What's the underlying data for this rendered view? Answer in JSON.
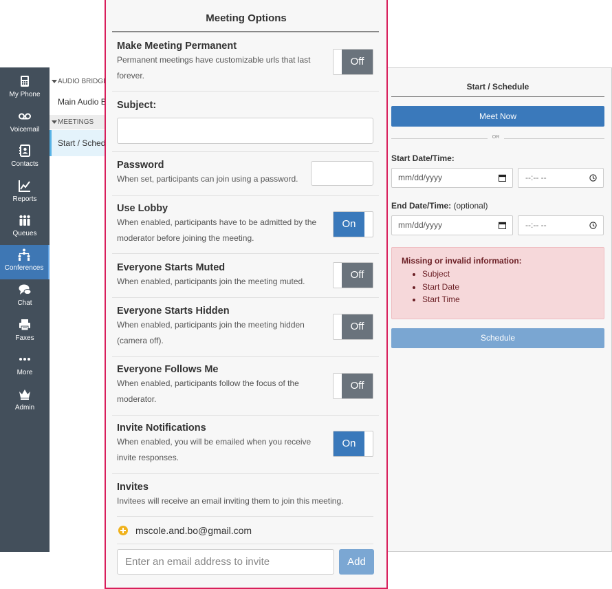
{
  "nav": {
    "items": [
      {
        "label": "My Phone",
        "icon": "phone-icon"
      },
      {
        "label": "Voicemail",
        "icon": "voicemail-icon"
      },
      {
        "label": "Contacts",
        "icon": "contacts-icon"
      },
      {
        "label": "Reports",
        "icon": "reports-icon"
      },
      {
        "label": "Queues",
        "icon": "queues-icon"
      },
      {
        "label": "Conferences",
        "icon": "conferences-icon",
        "active": true
      },
      {
        "label": "Chat",
        "icon": "chat-icon"
      },
      {
        "label": "Faxes",
        "icon": "fax-icon"
      },
      {
        "label": "More",
        "icon": "more-icon"
      },
      {
        "label": "Admin",
        "icon": "admin-crown-icon"
      }
    ]
  },
  "list": {
    "audio_header": "AUDIO BRIDGES",
    "audio_item": "Main Audio B",
    "meetings_header": "MEETINGS",
    "meetings_item": "Start / Schedu"
  },
  "schedule": {
    "title": "Start / Schedule",
    "meet_now": "Meet Now",
    "or": "OR",
    "start_label": "Start Date/Time:",
    "end_label": "End Date/Time:",
    "end_optional": "(optional)",
    "date_placeholder": "mm/dd/yyyy",
    "time_placeholder": "--:-- --",
    "error_title": "Missing or invalid information:",
    "errors": [
      "Subject",
      "Start Date",
      "Start Time"
    ],
    "schedule_button": "Schedule",
    "colors": {
      "primary": "#3a79bb",
      "alert_bg": "#f6d8da",
      "alert_text": "#6b1f25"
    }
  },
  "modal": {
    "title": "Meeting Options",
    "border_color": "#d81e5b",
    "permanent": {
      "heading": "Make Meeting Permanent",
      "desc1": "Permanent meetings have customizable urls that last",
      "desc2": "forever.",
      "state": "Off"
    },
    "subject": {
      "heading": "Subject:",
      "value": ""
    },
    "password": {
      "heading": "Password",
      "desc": "When set, participants can join using a password.",
      "value": ""
    },
    "lobby": {
      "heading": "Use Lobby",
      "desc1": "When enabled, participants have to be admitted by the",
      "desc2": "moderator before joining the meeting.",
      "state": "On"
    },
    "muted": {
      "heading": "Everyone Starts Muted",
      "desc": "When enabled, participants join the meeting muted.",
      "state": "Off"
    },
    "hidden": {
      "heading": "Everyone Starts Hidden",
      "desc1": "When enabled, participants join the meeting hidden",
      "desc2": "(camera off).",
      "state": "Off"
    },
    "follows": {
      "heading": "Everyone Follows Me",
      "desc1": "When enabled, participants follow the focus of the",
      "desc2": "moderator.",
      "state": "Off"
    },
    "invite_notif": {
      "heading": "Invite Notifications",
      "desc1": "When enabled, you will be emailed when you receive",
      "desc2": "invite responses.",
      "state": "On"
    },
    "invites": {
      "heading": "Invites",
      "desc": "Invitees will receive an email inviting them to join this meeting.",
      "invitee": "mscole.and.bo@gmail.com",
      "input_placeholder": "Enter an email address to invite",
      "add_button": "Add"
    }
  }
}
